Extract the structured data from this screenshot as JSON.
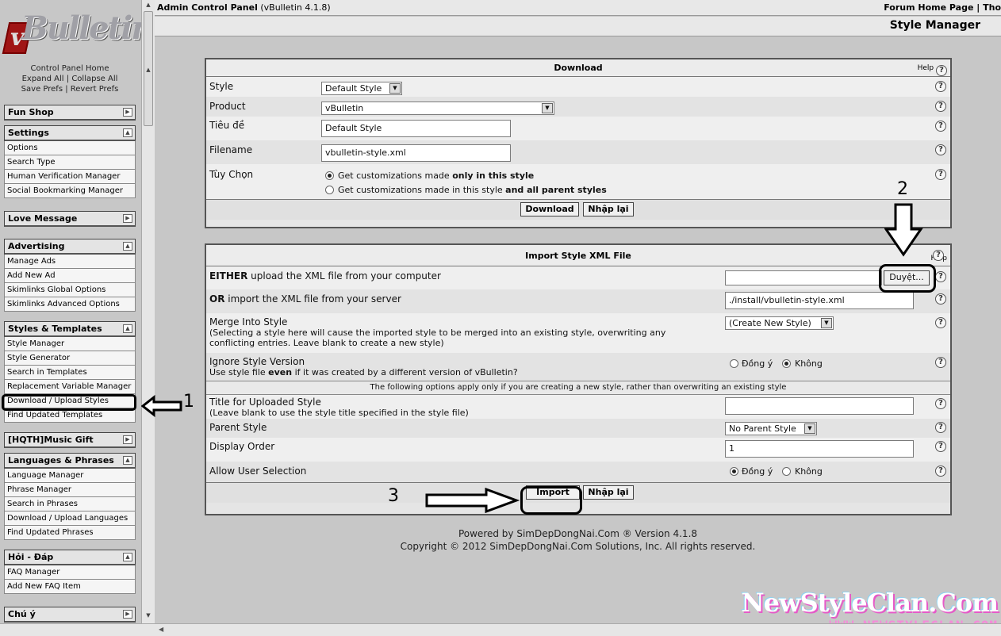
{
  "left": {
    "cp_links": [
      "Control Panel Home",
      "Expand All",
      "Collapse All",
      "Save Prefs",
      "Revert Prefs"
    ],
    "groups": [
      {
        "title": "Fun Shop",
        "items": []
      },
      {
        "title": "Settings",
        "items": [
          "Options",
          "Search Type",
          "Human Verification Manager",
          "Social Bookmarking Manager"
        ]
      },
      {
        "title": "Love Message",
        "items": []
      },
      {
        "title": "Advertising",
        "items": [
          "Manage Ads",
          "Add New Ad",
          "Skimlinks Global Options",
          "Skimlinks Advanced Options"
        ]
      },
      {
        "title": "Styles & Templates",
        "items": [
          "Style Manager",
          "Style Generator",
          "Search in Templates",
          "Replacement Variable Manager",
          "Download / Upload Styles",
          "Find Updated Templates"
        ]
      },
      {
        "title": "[HQTH]Music Gift",
        "items": []
      },
      {
        "title": "Languages & Phrases",
        "items": [
          "Language Manager",
          "Phrase Manager",
          "Search in Phrases",
          "Download / Upload Languages",
          "Find Updated Phrases"
        ]
      },
      {
        "title": "Hỏi - Đáp",
        "items": [
          "FAQ Manager",
          "Add New FAQ Item"
        ]
      },
      {
        "title": "Chú ý",
        "items": []
      }
    ]
  },
  "topbar": {
    "title": "Admin Control Panel",
    "version": "(vBulletin 4.1.8)",
    "right": "Forum Home Page | Tho"
  },
  "page_title": "Style Manager",
  "download": {
    "header": "Download",
    "help": "Help",
    "style_label": "Style",
    "style_value": "Default Style",
    "product_label": "Product",
    "product_value": "vBulletin",
    "title_label": "Tiêu đề",
    "title_value": "Default Style",
    "filename_label": "Filename",
    "filename_value": "vbulletin-style.xml",
    "options_label": "Tùy Chọn",
    "opt1_a": "Get customizations made ",
    "opt1_b": "only in this style",
    "opt2_a": "Get customizations made in this style ",
    "opt2_b": "and all parent styles",
    "btn_download": "Download",
    "btn_reset": "Nhập lại"
  },
  "import": {
    "header": "Import Style XML File",
    "help": "Help",
    "either_b": "EITHER",
    "either_t": " upload the XML file from your computer",
    "browse": "Duyệt...",
    "or_b": "OR",
    "or_t": " import the XML file from your server",
    "server_path": "./install/vbulletin-style.xml",
    "merge_label": "Merge Into Style",
    "merge_desc": "(Selecting a style here will cause the imported style to be merged into an existing style, overwriting any conflicting entries. Leave blank to create a new style)",
    "merge_value": "(Create New Style)",
    "ignore_label": "Ignore Style Version",
    "ignore_desc_a": "Use style file ",
    "ignore_desc_b": "even",
    "ignore_desc_c": " if it was created by a different version of vBulletin?",
    "yes": "Đồng ý",
    "no": "Không",
    "notice": "The following options apply only if you are creating a new style, rather than overwriting an existing style",
    "upl_title_label": "Title for Uploaded Style",
    "upl_title_desc": "(Leave blank to use the style title specified in the style file)",
    "parent_label": "Parent Style",
    "parent_value": "No Parent Style",
    "order_label": "Display Order",
    "order_value": "1",
    "allow_label": "Allow User Selection",
    "btn_import": "Import",
    "btn_reset": "Nhập lại"
  },
  "annotations": {
    "n1": "1",
    "n2": "2",
    "n3": "3"
  },
  "footer": {
    "line1": "Powered by SimDepDongNai.Com ® Version 4.1.8",
    "line2": "Copyright © 2012 SimDepDongNai.Com Solutions, Inc. All rights reserved."
  },
  "watermark": {
    "line1": "NewStyleClan.Com",
    "line2": "WWW.NEWSTYLECLAN.COM"
  }
}
